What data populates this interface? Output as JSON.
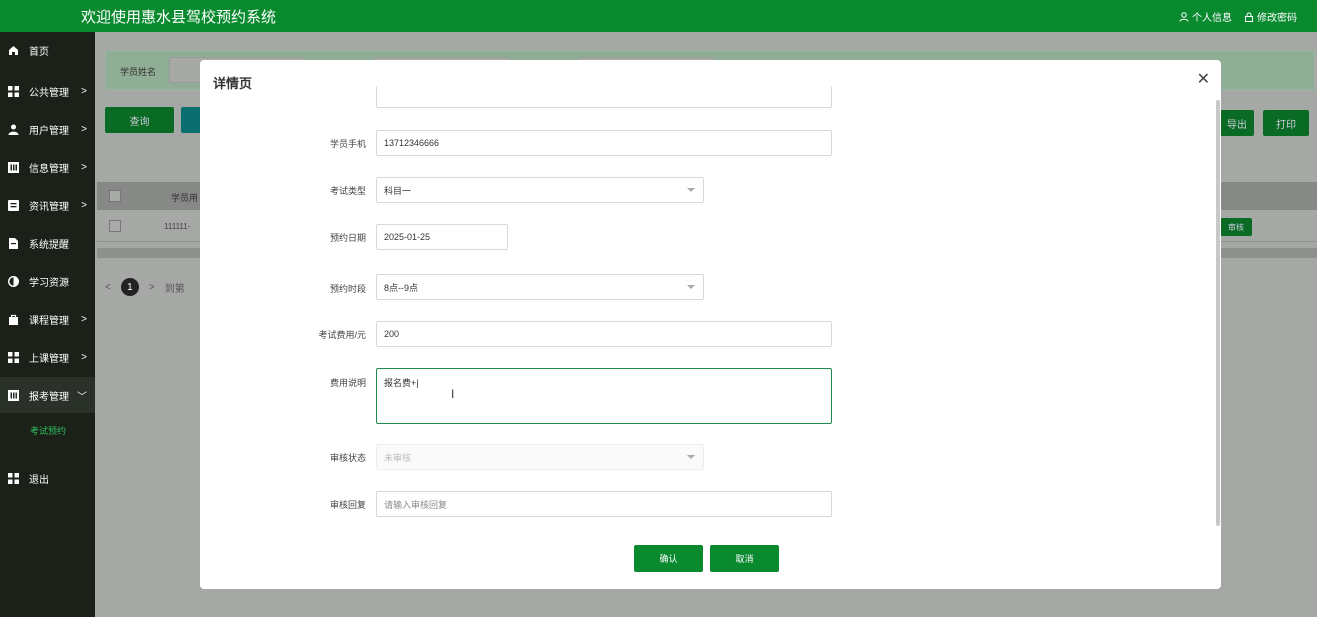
{
  "header": {
    "title": "欢迎使用惠水县驾校预约系统",
    "profile_label": "个人信息",
    "password_label": "修改密码"
  },
  "sidebar": {
    "items": [
      {
        "label": "首页",
        "icon": "home-icon"
      },
      {
        "label": "公共管理",
        "icon": "grid-icon"
      },
      {
        "label": "用户管理",
        "icon": "user-icon"
      },
      {
        "label": "信息管理",
        "icon": "panel-icon"
      },
      {
        "label": "资讯管理",
        "icon": "list-icon"
      },
      {
        "label": "系统提醒",
        "icon": "bell-icon"
      },
      {
        "label": "学习资源",
        "icon": "contrast-icon"
      },
      {
        "label": "课程管理",
        "icon": "bag-icon"
      },
      {
        "label": "上课管理",
        "icon": "grid-icon"
      },
      {
        "label": "报考管理",
        "icon": "panel-icon"
      },
      {
        "label": "退出",
        "icon": "grid-icon"
      }
    ],
    "sub_item": "考试预约"
  },
  "background": {
    "search_label": "学员姓名",
    "query_button": "查询",
    "export_button": "导出",
    "print_button": "打印",
    "col_header": "学员用",
    "row_cell": "111111-",
    "audit_button": "审核",
    "page_num": "1",
    "goto_label": "到第"
  },
  "modal": {
    "title": "详情页",
    "fields": {
      "phone_label": "学员手机",
      "phone_value": "13712346666",
      "exam_type_label": "考试类型",
      "exam_type_value": "科目一",
      "date_label": "预约日期",
      "date_value": "2025-01-25",
      "slot_label": "预约时段",
      "slot_value": "8点--9点",
      "fee_label": "考试费用/元",
      "fee_value": "200",
      "fee_note_label": "费用说明",
      "fee_note_value": "报名费+|",
      "status_label": "审核状态",
      "status_value": "未审核",
      "reply_label": "审核回复",
      "reply_placeholder": "请输入审核回复"
    },
    "confirm_button": "确认",
    "cancel_button": "取消"
  }
}
